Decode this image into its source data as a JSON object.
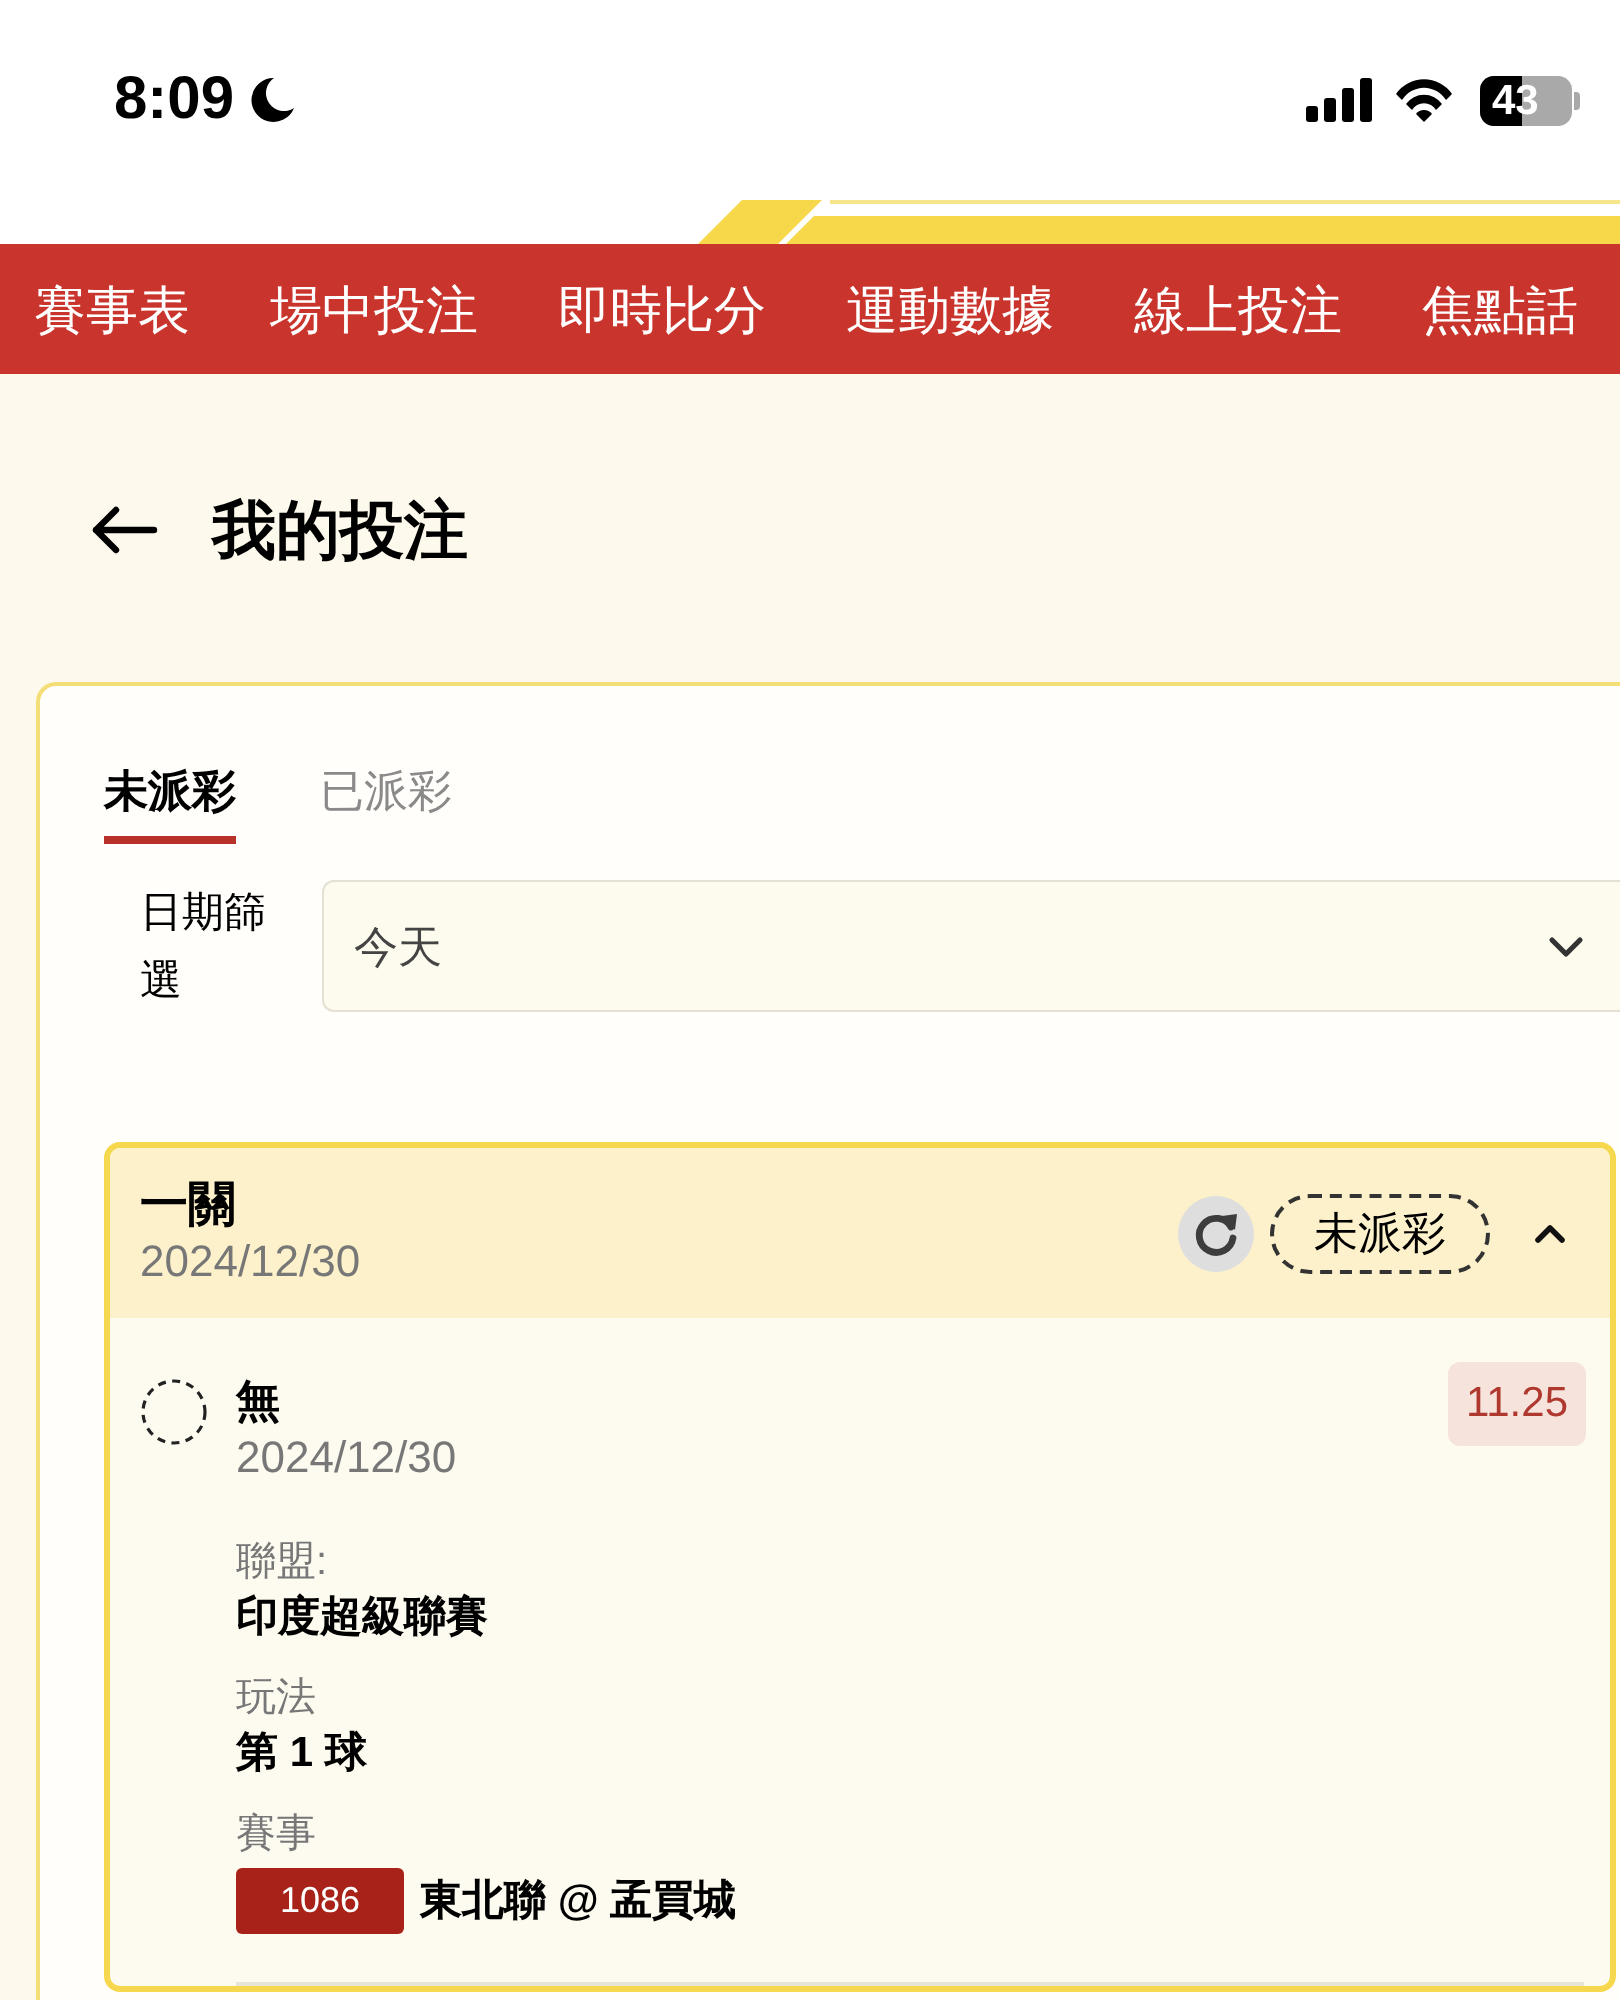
{
  "status_bar": {
    "time": "8:09",
    "battery": "43"
  },
  "nav": {
    "items": [
      "賽事表",
      "場中投注",
      "即時比分",
      "運動數據",
      "線上投注",
      "焦點話"
    ]
  },
  "page": {
    "title": "我的投注"
  },
  "tabs": [
    {
      "label": "未派彩",
      "selected": true
    },
    {
      "label": "已派彩",
      "selected": false
    }
  ],
  "date_filter": {
    "label": "日期篩選",
    "value": "今天"
  },
  "bets": [
    {
      "type": "一關",
      "date": "2024/12/30",
      "status": "未派彩",
      "expanded": true,
      "selections": [
        {
          "name": "無",
          "date": "2024/12/30",
          "odds": "11.25",
          "fields": [
            {
              "kind": "text",
              "label": "聯盟:",
              "value": "印度超級聯賽"
            },
            {
              "kind": "text",
              "label": "玩法",
              "value": "第 1 球"
            },
            {
              "kind": "match",
              "label": "賽事",
              "match_no": "1086",
              "value": "東北聯 @ 孟買城"
            }
          ]
        }
      ]
    }
  ]
}
